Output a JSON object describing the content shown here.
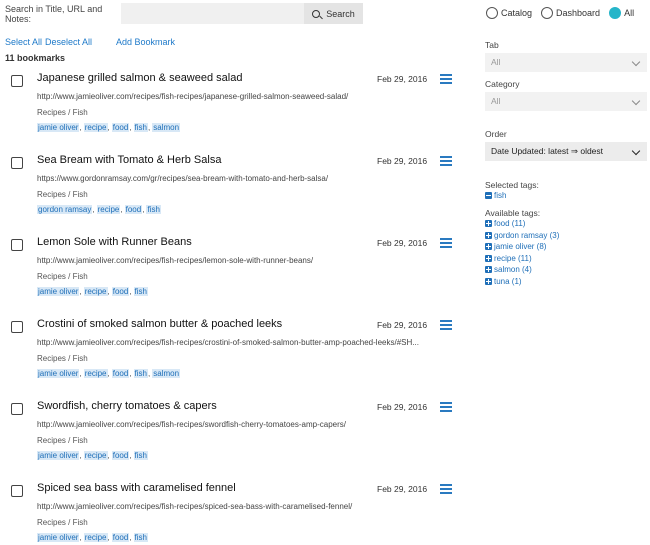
{
  "search": {
    "label": "Search in Title, URL and Notes:",
    "value": "",
    "button": "Search"
  },
  "view": [
    {
      "label": "Catalog",
      "selected": false
    },
    {
      "label": "Dashboard",
      "selected": false
    },
    {
      "label": "All",
      "selected": true
    }
  ],
  "actions": {
    "select_all": "Select All",
    "deselect_all": "Deselect All",
    "add": "Add Bookmark"
  },
  "count": "11 bookmarks",
  "bookmarks": [
    {
      "title": "Japanese grilled salmon & seaweed salad",
      "date": "Feb 29, 2016",
      "url": "http://www.jamieoliver.com/recipes/fish-recipes/japanese-grilled-salmon-seaweed-salad/",
      "category": "Recipes / Fish",
      "tags": [
        "jamie oliver",
        "recipe",
        "food",
        "fish",
        "salmon"
      ]
    },
    {
      "title": "Sea Bream with Tomato & Herb Salsa",
      "date": "Feb 29, 2016",
      "url": "https://www.gordonramsay.com/gr/recipes/sea-bream-with-tomato-and-herb-salsa/",
      "category": "Recipes / Fish",
      "tags": [
        "gordon ramsay",
        "recipe",
        "food",
        "fish"
      ]
    },
    {
      "title": "Lemon Sole with Runner Beans",
      "date": "Feb 29, 2016",
      "url": "http://www.jamieoliver.com/recipes/fish-recipes/lemon-sole-with-runner-beans/",
      "category": "Recipes / Fish",
      "tags": [
        "jamie oliver",
        "recipe",
        "food",
        "fish"
      ]
    },
    {
      "title": "Crostini of smoked salmon butter & poached leeks",
      "date": "Feb 29, 2016",
      "url": "http://www.jamieoliver.com/recipes/fish-recipes/crostini-of-smoked-salmon-butter-amp-poached-leeks/#SH...",
      "category": "Recipes / Fish",
      "tags": [
        "jamie oliver",
        "recipe",
        "food",
        "fish",
        "salmon"
      ]
    },
    {
      "title": "Swordfish, cherry tomatoes & capers",
      "date": "Feb 29, 2016",
      "url": "http://www.jamieoliver.com/recipes/fish-recipes/swordfish-cherry-tomatoes-amp-capers/",
      "category": "Recipes / Fish",
      "tags": [
        "jamie oliver",
        "recipe",
        "food",
        "fish"
      ]
    },
    {
      "title": "Spiced sea bass with caramelised fennel",
      "date": "Feb 29, 2016",
      "url": "http://www.jamieoliver.com/recipes/fish-recipes/spiced-sea-bass-with-caramelised-fennel/",
      "category": "Recipes / Fish",
      "tags": [
        "jamie oliver",
        "recipe",
        "food",
        "fish"
      ]
    }
  ],
  "sidebar": {
    "tab_label": "Tab",
    "tab_value": "All",
    "category_label": "Category",
    "category_value": "All",
    "order_label": "Order",
    "order_value": "Date Updated: latest ⇒ oldest",
    "selected_tags_label": "Selected tags:",
    "selected_tags": [
      "fish"
    ],
    "available_tags_label": "Available tags:",
    "available_tags": [
      "food (11)",
      "gordon ramsay (3)",
      "jamie oliver (8)",
      "recipe (11)",
      "salmon (4)",
      "tuna (1)"
    ]
  },
  "colors": {
    "accent": "#26b5c9",
    "link": "#1f7ac9",
    "tag_bg": "#d8e8f6"
  }
}
